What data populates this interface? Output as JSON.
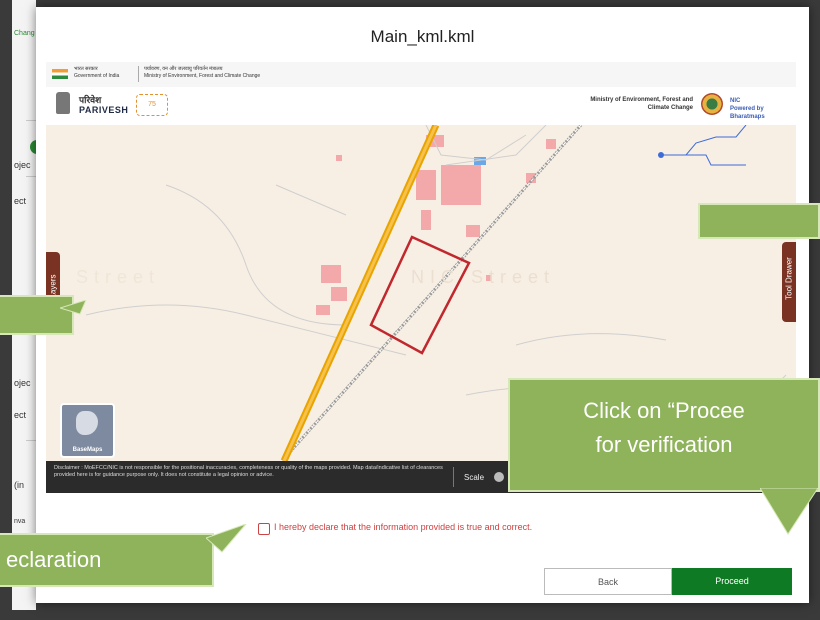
{
  "background": {
    "fragments": [
      "Chang",
      "ojec",
      "ect",
      "ojec",
      "ect",
      "(in",
      "nva"
    ]
  },
  "modal": {
    "title": "Main_kml.kml"
  },
  "gov_bar": {
    "hindi_govt": "भारत सरकार",
    "english_govt": "Government of India",
    "hindi_ministry": "पर्यावरण, वन और जलवायु परिवर्तन मंत्रालय",
    "english_ministry": "Ministry of Environment, Forest and Climate Change"
  },
  "brand_bar": {
    "parivesh_hindi": "परिवेश",
    "parivesh_english": "PARIVESH",
    "azadi": "75",
    "ministry_line1": "Ministry of Environment, Forest and",
    "ministry_line2": "Climate Change",
    "nic_line1": "NIC",
    "nic_line2": "Powered by Bharatmaps"
  },
  "map": {
    "watermark_left": "Street",
    "watermark_right": "NIC Street",
    "layers_label": "Layers",
    "tool_label": "Tool Drawer",
    "basemaps_label": "BaseMaps"
  },
  "disclaimer": {
    "text": "Disclaimer : MoEFCC/NIC is not responsible for the positional inaccuracies, completeness or quality of the maps provided. Map data/indicative list of clearances provided here is for guidance purpose only. It does not constitute a legal opinion or advice.",
    "scale_label": "Scale"
  },
  "declaration": {
    "text": "I hereby declare that the information provided is true and correct."
  },
  "buttons": {
    "back": "Back",
    "proceed": "Proceed"
  },
  "callouts": {
    "proceed_line1": "Click on “Procee",
    "proceed_line2": "for verification",
    "declaration": "eclaration"
  },
  "colors": {
    "proceed_button": "#0f7a24",
    "callout": "#8fb35b",
    "declaration_text": "#d04040",
    "polygon": "#c0282e"
  }
}
